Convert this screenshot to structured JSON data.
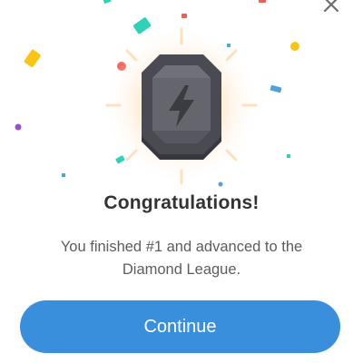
{
  "dialog": {
    "title": "Congratulations!",
    "message": "You finished #1 and advanced to the Diamond League.",
    "continue_label": "Continue",
    "close_icon": "close-icon",
    "badge_icon": "lightning-bolt-icon"
  },
  "colors": {
    "accent": "#3a8fdc",
    "badge_dark": "#4a4a52",
    "badge_face": "#6a6a72",
    "glow": "#ffd9a8",
    "confetti_yellow": "#f9c512",
    "confetti_teal": "#2ed3b7",
    "confetti_red": "#f25c54",
    "confetti_blue": "#4aa3df",
    "confetti_purple": "#9b4dd6"
  }
}
